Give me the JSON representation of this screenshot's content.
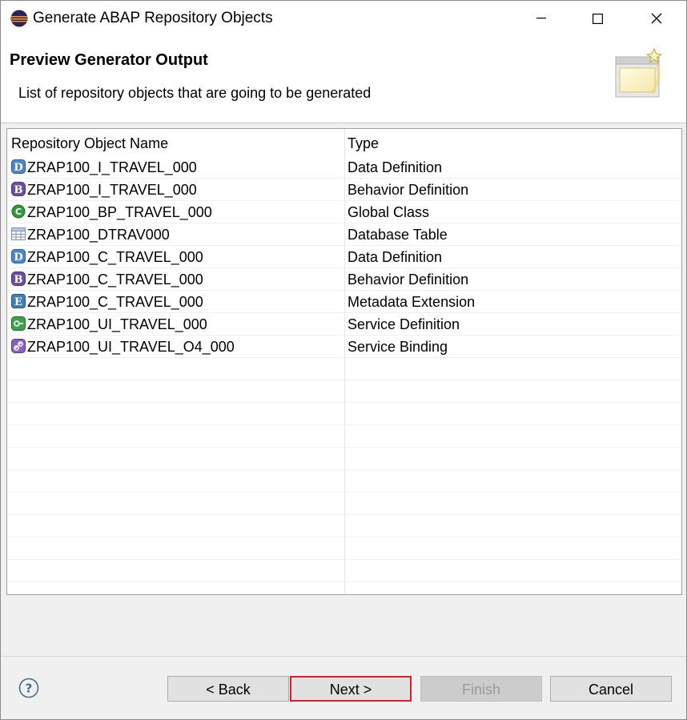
{
  "window": {
    "title": "Generate ABAP Repository Objects"
  },
  "header": {
    "title": "Preview Generator Output",
    "description": "List of repository objects that are going to be generated"
  },
  "table": {
    "columns": [
      "Repository Object Name",
      "Type"
    ],
    "rows": [
      {
        "icon": "data-definition-icon",
        "name": "ZRAP100_I_TRAVEL_000",
        "type": "Data Definition"
      },
      {
        "icon": "behavior-definition-icon",
        "name": "ZRAP100_I_TRAVEL_000",
        "type": "Behavior Definition"
      },
      {
        "icon": "global-class-icon",
        "name": "ZRAP100_BP_TRAVEL_000",
        "type": "Global Class"
      },
      {
        "icon": "database-table-icon",
        "name": "ZRAP100_DTRAV000",
        "type": "Database Table"
      },
      {
        "icon": "data-definition-icon",
        "name": "ZRAP100_C_TRAVEL_000",
        "type": "Data Definition"
      },
      {
        "icon": "behavior-definition-icon",
        "name": "ZRAP100_C_TRAVEL_000",
        "type": "Behavior Definition"
      },
      {
        "icon": "metadata-extension-icon",
        "name": "ZRAP100_C_TRAVEL_000",
        "type": "Metadata Extension"
      },
      {
        "icon": "service-definition-icon",
        "name": "ZRAP100_UI_TRAVEL_000",
        "type": "Service Definition"
      },
      {
        "icon": "service-binding-icon",
        "name": "ZRAP100_UI_TRAVEL_O4_000",
        "type": "Service Binding"
      }
    ]
  },
  "buttons": {
    "back": "< Back",
    "next": "Next >",
    "finish": "Finish",
    "cancel": "Cancel"
  },
  "colors": {
    "focus_border": "#d6202a",
    "data_definition": "#4a86c8",
    "behavior_definition": "#6a4fa3",
    "global_class": "#2e9a3a",
    "service_binding": "#8a5fc4"
  }
}
